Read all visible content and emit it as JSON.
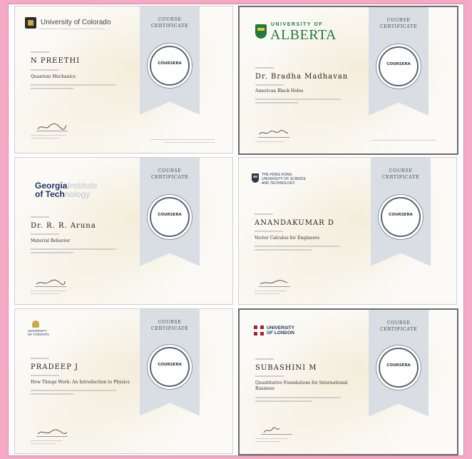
{
  "certificates": [
    {
      "institution": "University of Colorado",
      "ribbon_title": "COURSE\nCERTIFICATE",
      "recipient": "N PREETHI",
      "course": "Quantum Mechanics",
      "seal": "COURSERA"
    },
    {
      "institution": "UNIVERSITY OF",
      "institution_big": "ALBERTA",
      "ribbon_title": "COURSE\nCERTIFICATE",
      "recipient": "Dr. Bradha Madhavan",
      "course": "American Black Holes",
      "seal": "COURSERA"
    },
    {
      "institution_line1": "Georgia",
      "institution_line1b": "Institute",
      "institution_line2": "of Tech",
      "institution_line2b": "nology",
      "ribbon_title": "COURSE\nCERTIFICATE",
      "recipient": "Dr. R. R. Aruna",
      "course": "Material Behavior",
      "seal": "COURSERA"
    },
    {
      "institution": "THE HONG KONG\nUNIVERSITY OF SCIENCE\nAND TECHNOLOGY",
      "ribbon_title": "COURSE\nCERTIFICATE",
      "recipient": "ANANDAKUMAR D",
      "course": "Vector Calculus for Engineers",
      "seal": "COURSERA"
    },
    {
      "institution": "UNIVERSITY\nOF TORONTO",
      "ribbon_title": "COURSE\nCERTIFICATE",
      "recipient": "PRADEEP J",
      "course": "How Things Work: An Introduction to Physics",
      "seal": "COURSERA"
    },
    {
      "institution": "UNIVERSITY\nOF LONDON",
      "ribbon_title": "COURSE\nCERTIFICATE",
      "recipient": "SUBASHINI M",
      "course": "Quantitative Foundations for International Business",
      "seal": "COURSERA"
    }
  ],
  "colors": {
    "background": "#f4a9c4",
    "ribbon": "#d9dde4",
    "alberta_green": "#1f7a3b"
  }
}
